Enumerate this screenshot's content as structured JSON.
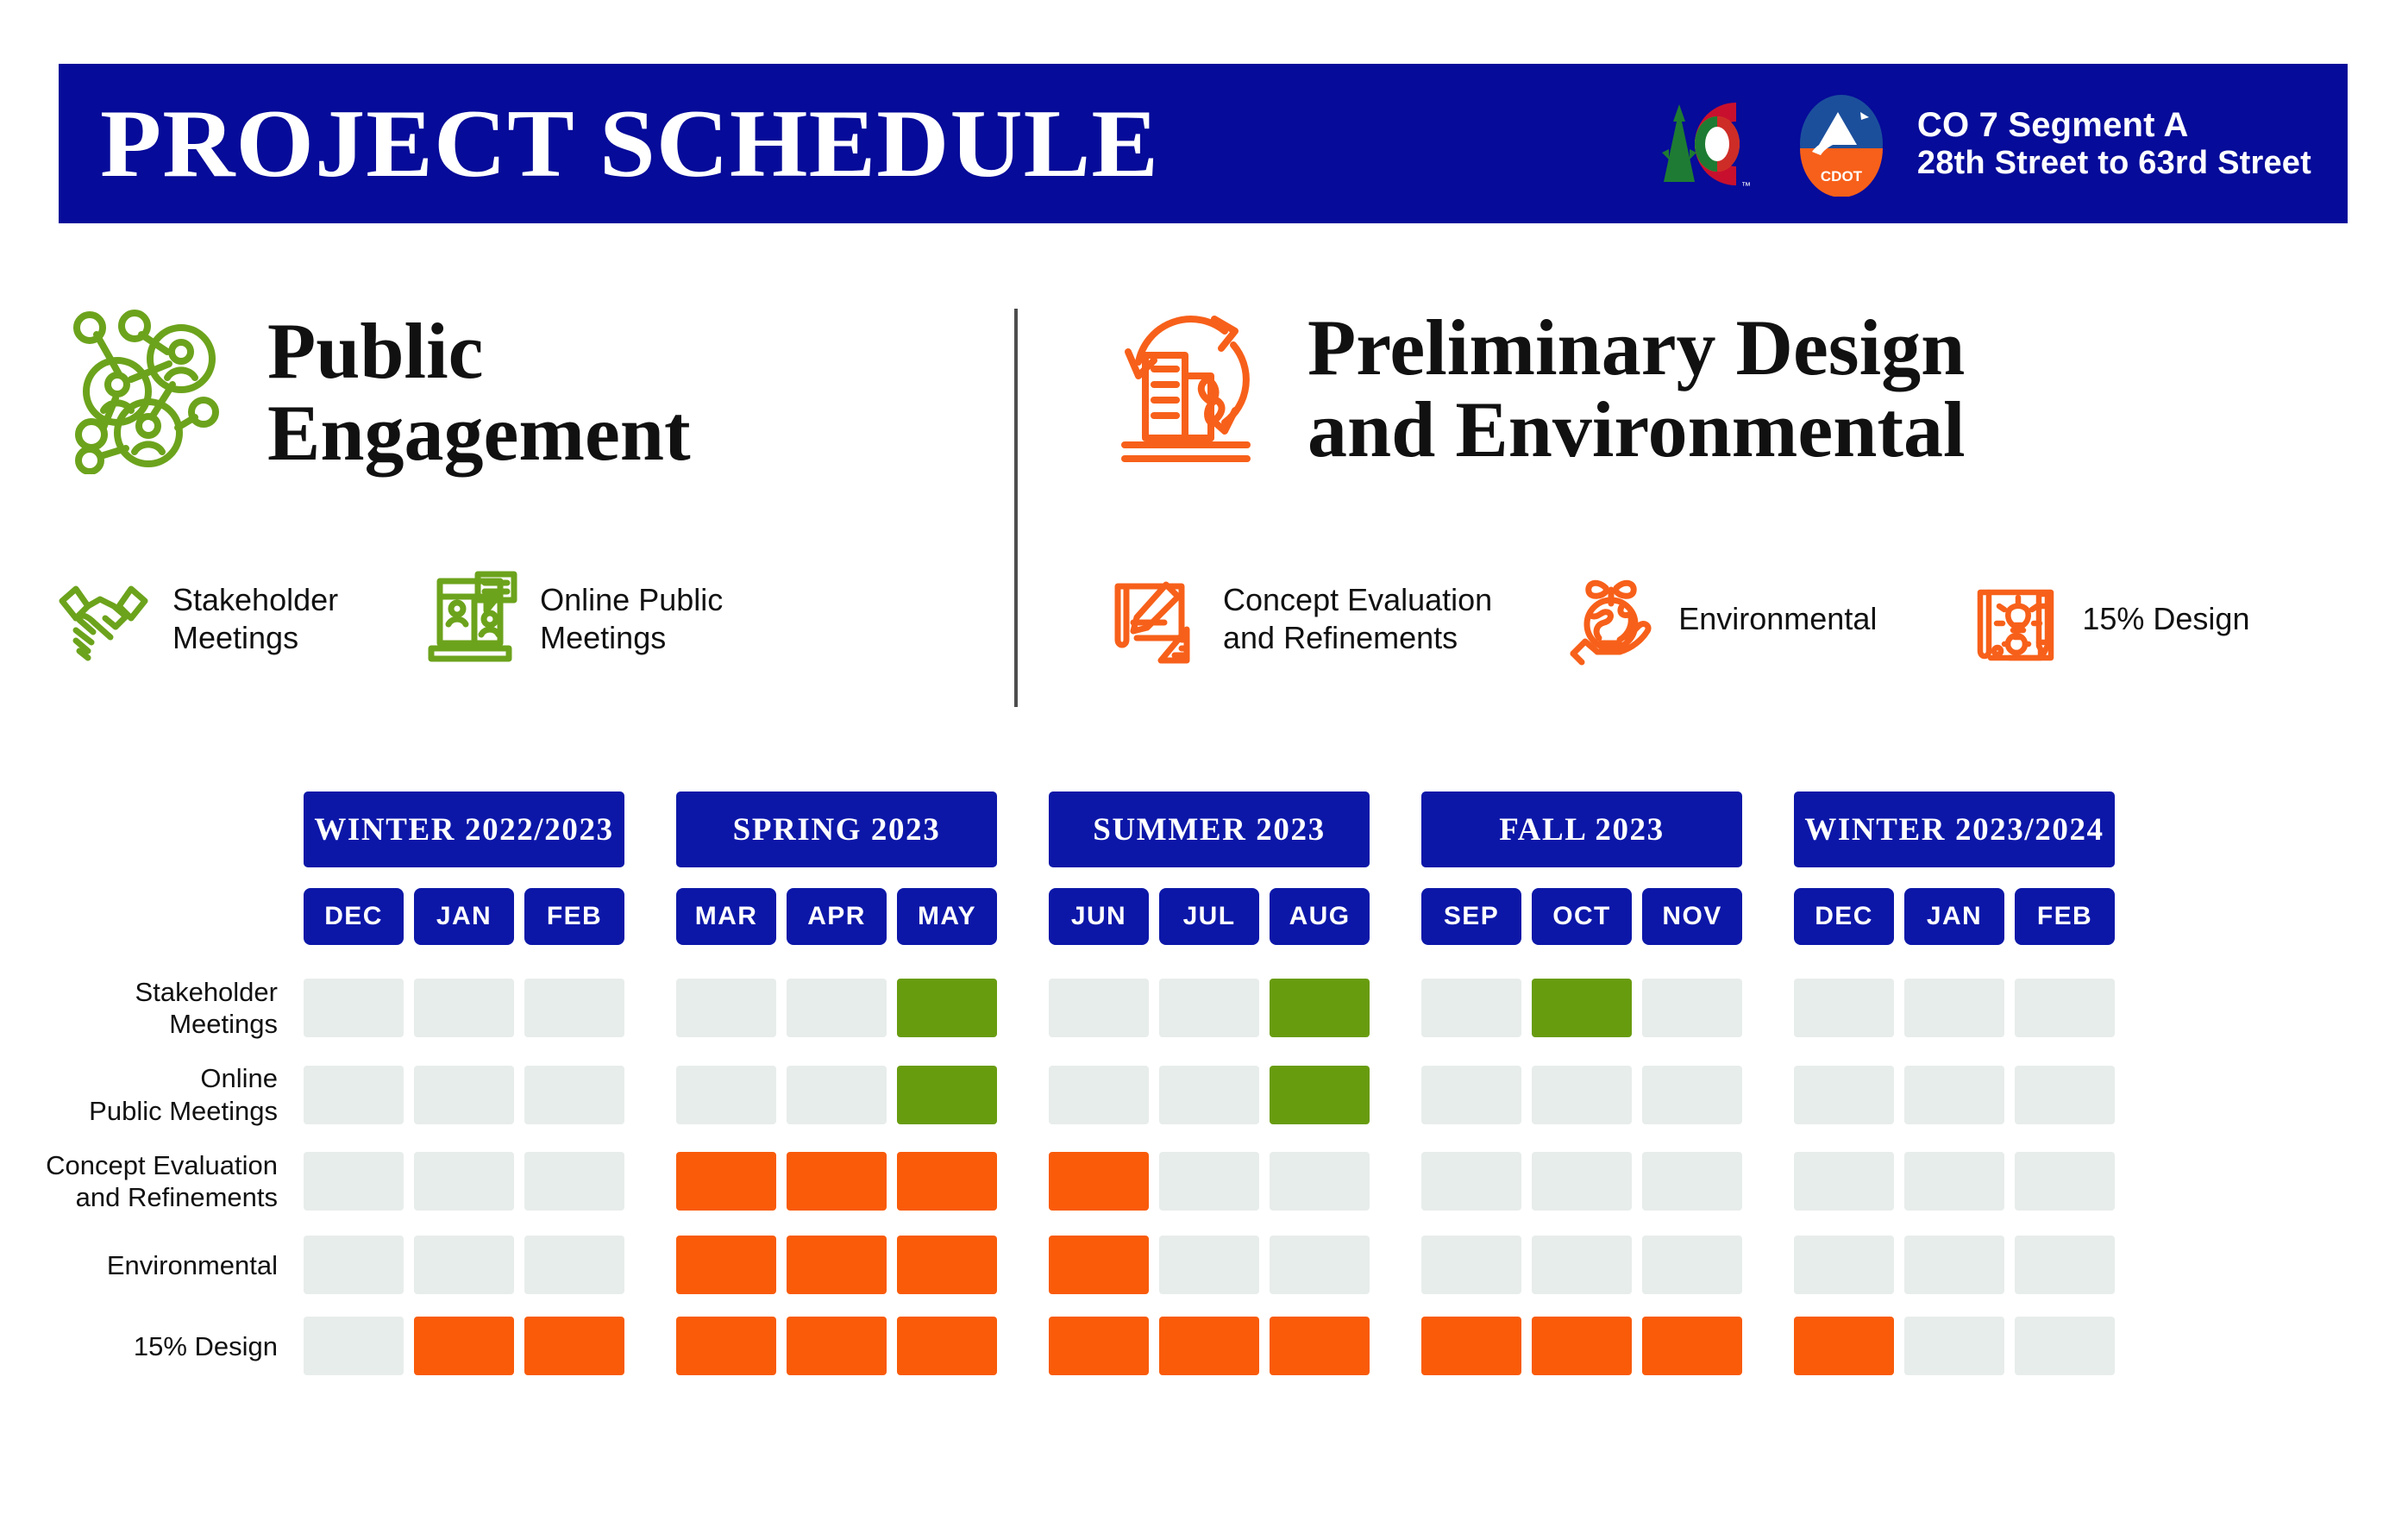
{
  "header": {
    "title": "PROJECT SCHEDULE",
    "project_name": "CO 7 Segment A",
    "project_extent": "28th Street to 63rd Street",
    "logos": [
      "colorado-state-logo",
      "cdot-logo"
    ]
  },
  "colors": {
    "navy": "#060B99",
    "chip_navy": "#0C17A8",
    "green": "#689C0F",
    "orange": "#F95B09",
    "empty_cell": "#E7EDEB",
    "text": "#111111",
    "divider": "#4D4D4D"
  },
  "categories": [
    {
      "id": "public-engagement",
      "title": "Public\nEngagement",
      "color": "#689C0F",
      "icon": "network-people-icon",
      "items": [
        {
          "label": "Stakeholder\nMeetings",
          "icon": "handshake-icon"
        },
        {
          "label": "Online Public\nMeetings",
          "icon": "video-meeting-icon"
        }
      ]
    },
    {
      "id": "prelim-design",
      "title": "Preliminary Design\nand Environmental",
      "color": "#F95B09",
      "icon": "building-recycle-icon",
      "items": [
        {
          "label": "Concept Evaluation\nand Refinements",
          "icon": "blueprint-pencil-icon"
        },
        {
          "label": "Environmental",
          "icon": "hand-globe-plant-icon"
        },
        {
          "label": "15% Design",
          "icon": "lightbulb-gear-pencil-icon"
        }
      ]
    }
  ],
  "chart_data": {
    "type": "table",
    "title": "PROJECT SCHEDULE",
    "seasons": [
      {
        "label": "WINTER 2022/2023",
        "span": 3
      },
      {
        "label": "SPRING 2023",
        "span": 3
      },
      {
        "label": "SUMMER 2023",
        "span": 3
      },
      {
        "label": "FALL 2023",
        "span": 3
      },
      {
        "label": "WINTER 2023/2024",
        "span": 3
      }
    ],
    "months": [
      "DEC",
      "JAN",
      "FEB",
      "MAR",
      "APR",
      "MAY",
      "JUN",
      "JUL",
      "AUG",
      "SEP",
      "OCT",
      "NOV",
      "DEC",
      "JAN",
      "FEB"
    ],
    "rows": [
      {
        "label": "Stakeholder\nMeetings",
        "color": "green",
        "cells": [
          "",
          "",
          "",
          "",
          "",
          "green",
          "",
          "",
          "green",
          "",
          "green",
          "",
          "",
          "",
          ""
        ]
      },
      {
        "label": "Online\nPublic Meetings",
        "color": "green",
        "cells": [
          "",
          "",
          "",
          "",
          "",
          "green",
          "",
          "",
          "green",
          "",
          "",
          "",
          "",
          "",
          ""
        ]
      },
      {
        "label": "Concept Evaluation\nand Refinements",
        "color": "orange",
        "cells": [
          "",
          "",
          "",
          "orange",
          "orange",
          "orange",
          "orange",
          "",
          "",
          "",
          "",
          "",
          "",
          "",
          ""
        ]
      },
      {
        "label": "Environmental",
        "color": "orange",
        "cells": [
          "",
          "",
          "",
          "orange",
          "orange",
          "orange",
          "orange",
          "",
          "",
          "",
          "",
          "",
          "",
          "",
          ""
        ]
      },
      {
        "label": "15% Design",
        "color": "orange",
        "cells": [
          "",
          "orange",
          "orange",
          "orange",
          "orange",
          "orange",
          "orange",
          "orange",
          "orange",
          "orange",
          "orange",
          "orange",
          "orange",
          "",
          ""
        ]
      }
    ],
    "legend_position": "top",
    "grid": false
  }
}
